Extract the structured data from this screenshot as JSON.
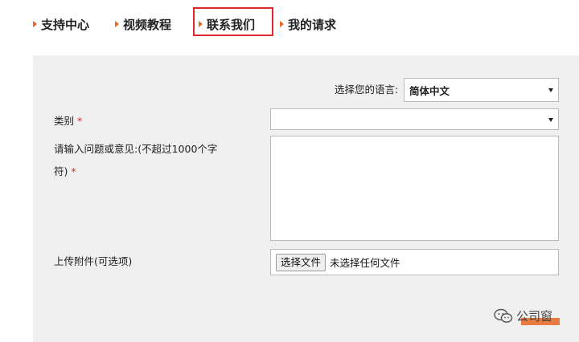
{
  "nav": {
    "items": [
      {
        "label": "支持中心"
      },
      {
        "label": "视频教程"
      },
      {
        "label": "联系我们"
      },
      {
        "label": "我的请求"
      }
    ],
    "accent_color": "#e8661f",
    "active_box_color": "#e0262c"
  },
  "form": {
    "language_label": "选择您的语言:",
    "language_value": "简体中文",
    "category_label": "类别",
    "category_value": "",
    "question_label_line1": "请输入问题或意见:(不超过1000个字",
    "question_label_line2": "符)",
    "required_mark": "*",
    "attachment_label": "上传附件(可选项)",
    "file_button_label": "选择文件",
    "file_status": "未选择任何文件"
  },
  "watermark": {
    "text": "公司窗"
  }
}
